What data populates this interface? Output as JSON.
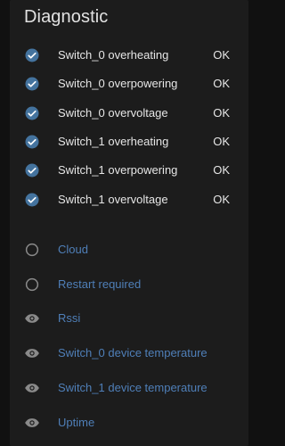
{
  "card": {
    "title": "Diagnostic"
  },
  "colors": {
    "check": "#44739e",
    "muted_icon": "#8a8a8a",
    "disabled_text": "#4f7fb8"
  },
  "enabled_entities": [
    {
      "label": "Switch_0 overheating",
      "state": "OK",
      "icon": "check-circle-icon"
    },
    {
      "label": "Switch_0 overpowering",
      "state": "OK",
      "icon": "check-circle-icon"
    },
    {
      "label": "Switch_0 overvoltage",
      "state": "OK",
      "icon": "check-circle-icon"
    },
    {
      "label": "Switch_1 overheating",
      "state": "OK",
      "icon": "check-circle-icon"
    },
    {
      "label": "Switch_1 overpowering",
      "state": "OK",
      "icon": "check-circle-icon"
    },
    {
      "label": "Switch_1 overvoltage",
      "state": "OK",
      "icon": "check-circle-icon"
    }
  ],
  "disabled_entities": [
    {
      "label": "Cloud",
      "icon": "circle-outline-icon"
    },
    {
      "label": "Restart required",
      "icon": "circle-outline-icon"
    },
    {
      "label": "Rssi",
      "icon": "eye-icon"
    },
    {
      "label": "Switch_0 device temperature",
      "icon": "eye-icon"
    },
    {
      "label": "Switch_1 device temperature",
      "icon": "eye-icon"
    },
    {
      "label": "Uptime",
      "icon": "eye-icon"
    }
  ]
}
